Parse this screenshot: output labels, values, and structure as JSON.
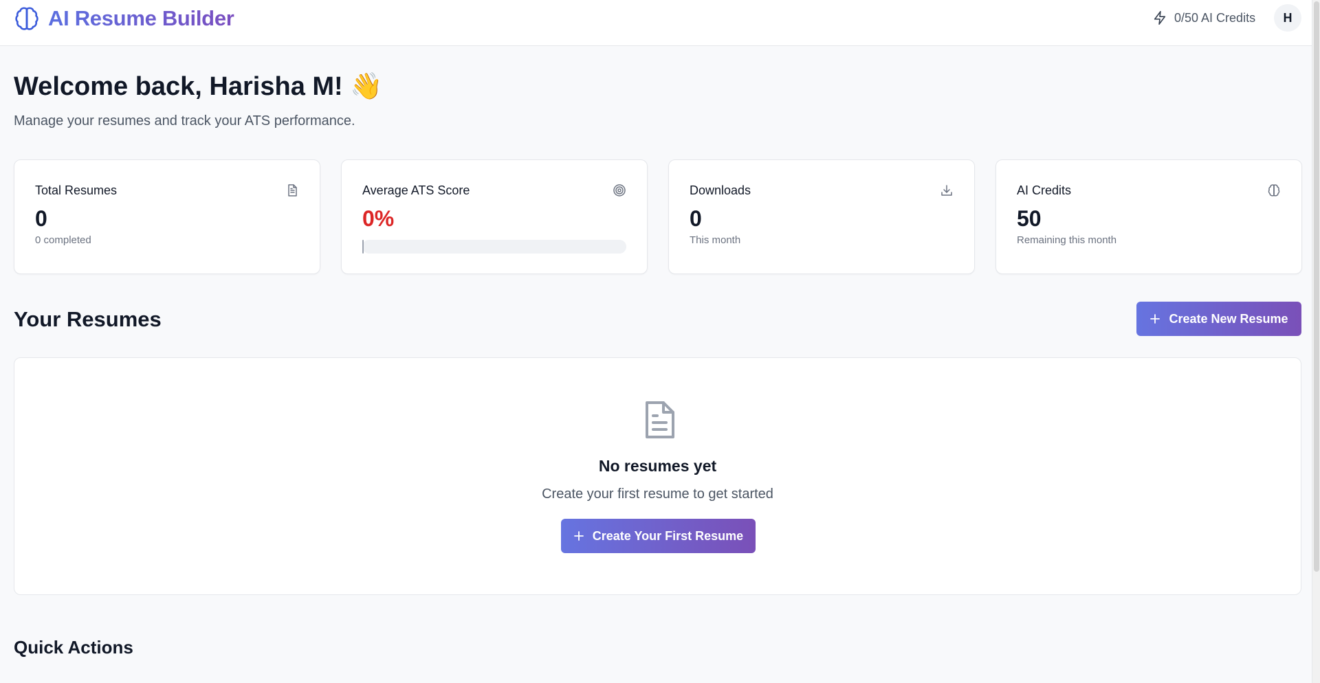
{
  "header": {
    "app_title": "AI Resume Builder",
    "credits_text": "0/50 AI Credits",
    "avatar_initial": "H",
    "brand_gradient": [
      "#5b6fe0",
      "#7a4ec0"
    ]
  },
  "welcome": {
    "title": "Welcome back, Harisha M! 👋",
    "subtitle": "Manage your resumes and track your ATS performance."
  },
  "stats": {
    "total_resumes": {
      "label": "Total Resumes",
      "value": "0",
      "note": "0 completed",
      "icon": "document-icon"
    },
    "ats_score": {
      "label": "Average ATS Score",
      "value": "0%",
      "progress": 0,
      "icon": "target-icon",
      "value_color": "#dc2626"
    },
    "downloads": {
      "label": "Downloads",
      "value": "0",
      "note": "This month",
      "icon": "download-icon"
    },
    "ai_credits": {
      "label": "AI Credits",
      "value": "50",
      "note": "Remaining this month",
      "icon": "brain-icon"
    }
  },
  "resumes": {
    "title": "Your Resumes",
    "create_button": "Create New Resume",
    "empty_title": "No resumes yet",
    "empty_subtitle": "Create your first resume to get started",
    "empty_button": "Create Your First Resume"
  },
  "quick_actions": {
    "title": "Quick Actions"
  },
  "colors": {
    "accent_start": "#6674e0",
    "accent_end": "#7a50b8",
    "danger": "#dc2626",
    "background": "#f8f9fb"
  }
}
